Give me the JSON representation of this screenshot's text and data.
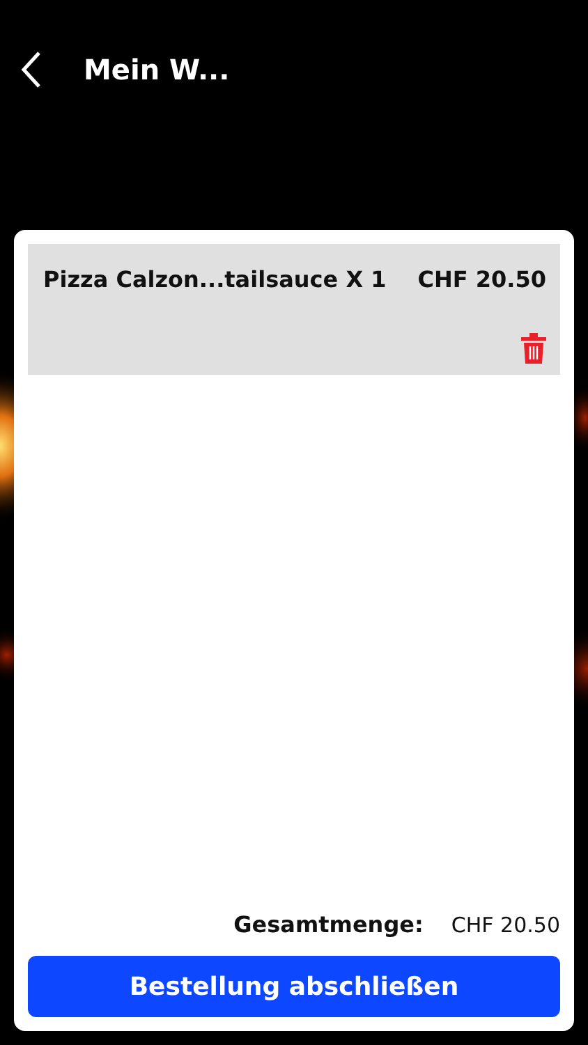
{
  "header": {
    "title": "Mein W..."
  },
  "cart": {
    "items": [
      {
        "name": "Pizza Calzon...tailsauce X 1",
        "price": "CHF 20.50"
      }
    ],
    "total_label": "Gesamtmenge:",
    "total": "CHF 20.50",
    "checkout": "Bestellung abschließen"
  }
}
